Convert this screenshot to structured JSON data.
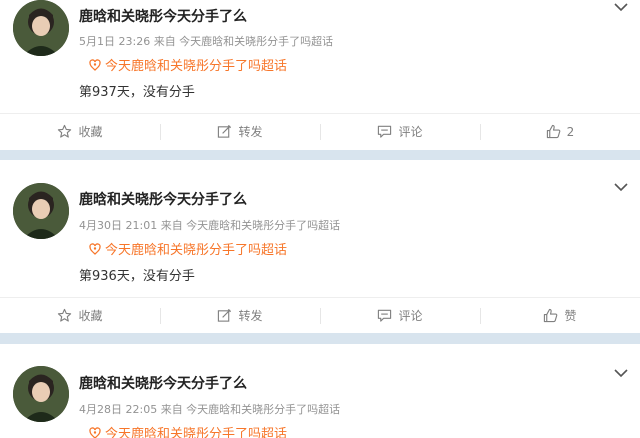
{
  "posts": [
    {
      "username": "鹿晗和关晓彤今天分手了么",
      "meta": "5月1日 23:26 来自 今天鹿晗和关晓彤分手了吗超话",
      "chaohua": "今天鹿晗和关晓彤分手了吗超话",
      "text": "第937天，没有分手",
      "actions": {
        "collect": "收藏",
        "repost": "转发",
        "comment": "评论",
        "like": "2"
      }
    },
    {
      "username": "鹿晗和关晓彤今天分手了么",
      "meta": "4月30日 21:01 来自 今天鹿晗和关晓彤分手了吗超话",
      "chaohua": "今天鹿晗和关晓彤分手了吗超话",
      "text": "第936天，没有分手",
      "actions": {
        "collect": "收藏",
        "repost": "转发",
        "comment": "评论",
        "like": "赞"
      }
    },
    {
      "username": "鹿晗和关晓彤今天分手了么",
      "meta": "4月28日 22:05 来自 今天鹿晗和关晓彤分手了吗超话",
      "chaohua": "今天鹿晗和关晓彤分手了吗超话"
    }
  ],
  "icons": {
    "collect": "star-icon",
    "repost": "edit-icon",
    "comment": "comment-icon",
    "like": "thumbs-up-icon",
    "more": "chevron-down-icon",
    "chaohua": "supertopic-icon"
  },
  "colors": {
    "separator": "#d8e4ee",
    "chaohua": "#f7762a",
    "meta": "#939393"
  }
}
